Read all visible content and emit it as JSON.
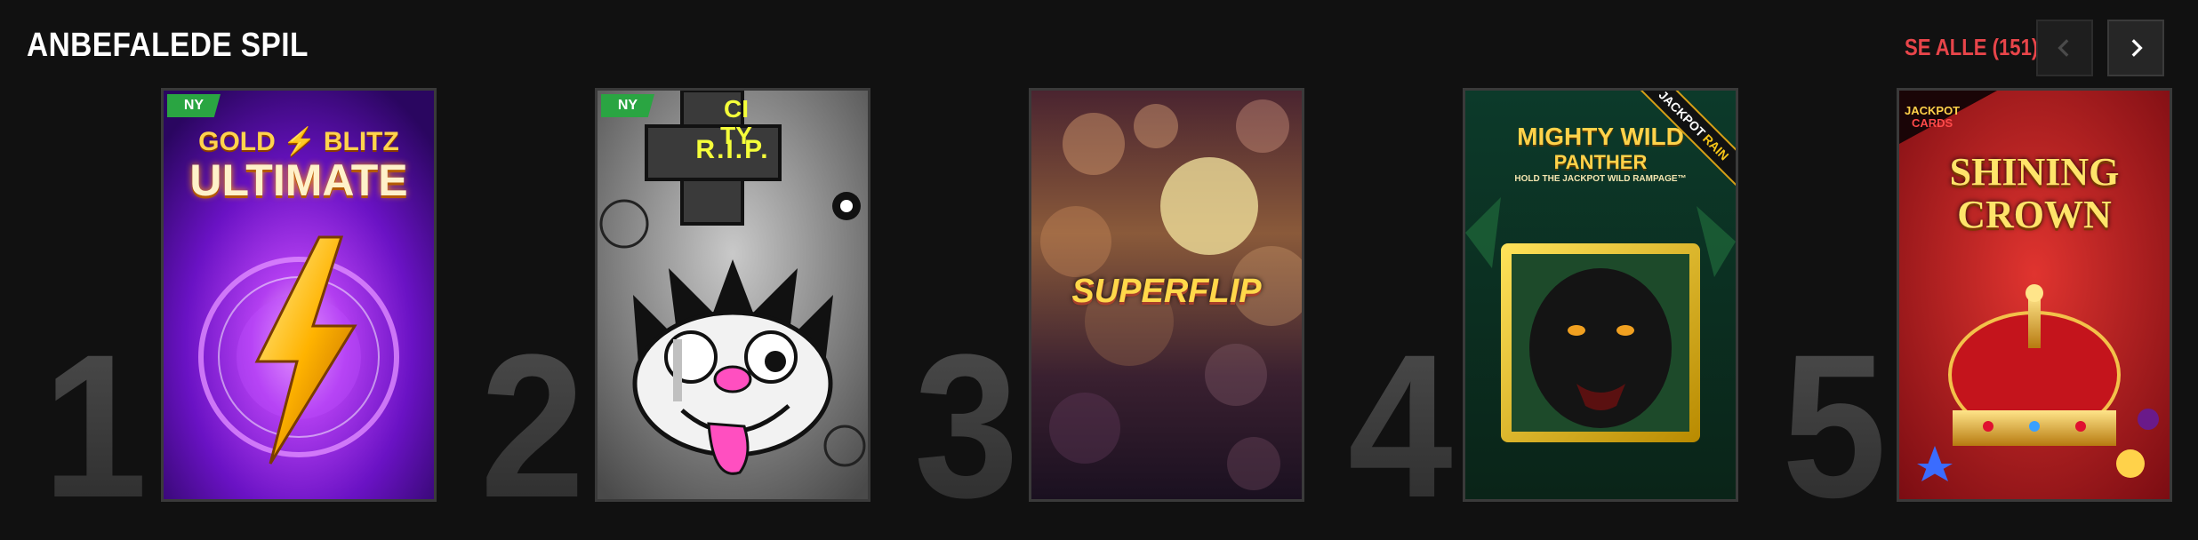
{
  "section": {
    "title": "ANBEFALEDE SPIL",
    "see_all_label": "SE ALLE (151)"
  },
  "games": [
    {
      "rank": "1",
      "badge": "NY",
      "logo_line1": "GOLD",
      "logo_line1b": "BLITZ",
      "logo_line2": "ULTIMATE"
    },
    {
      "rank": "2",
      "badge": "NY",
      "logo_rip": "R.I.P.",
      "logo_city": "CITY"
    },
    {
      "rank": "3",
      "logo": "SUPERFLIP"
    },
    {
      "rank": "4",
      "ribbon_a": "JACKPOT",
      "ribbon_b": "RAIN",
      "logo_line1": "MIGHTY WILD",
      "logo_line2": "PANTHER",
      "logo_sub": "HOLD THE JACKPOT WILD RAMPAGE™"
    },
    {
      "rank": "5",
      "corner_a": "JACKPOT",
      "corner_b": "CARDS",
      "logo_line1": "SHINING",
      "logo_line2": "CROWN"
    }
  ],
  "colors": {
    "background": "#111111",
    "accent": "#e8454a",
    "badge": "#2aa542"
  }
}
